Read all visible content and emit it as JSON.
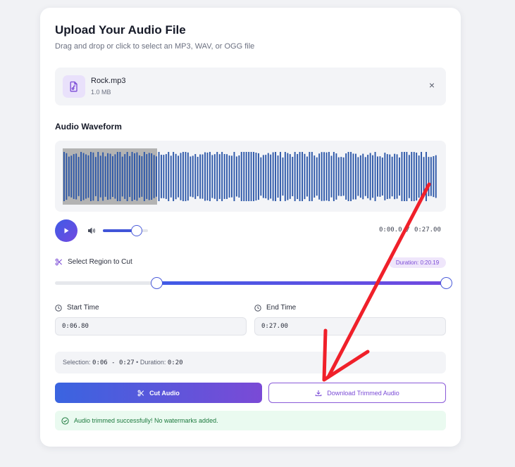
{
  "upload": {
    "title": "Upload Your Audio File",
    "subtitle": "Drag and drop or click to select an MP3, WAV, or OGG file"
  },
  "file": {
    "name": "Rock.mp3",
    "size": "1.0 MB",
    "icon": "audio-file-icon",
    "remove_icon": "×"
  },
  "waveform": {
    "title": "Audio Waveform",
    "selected_color": "#b3b3b3",
    "wave_color": "#2c57a8"
  },
  "player": {
    "play_icon": "play-icon",
    "volume_icon": "speaker-icon",
    "volume_level": 0.75,
    "current_time": "0:00.0",
    "total_time": "0:27.00"
  },
  "region": {
    "label": "Select Region to Cut",
    "duration_badge": "Duration: 0:20.19",
    "start_fraction": 0.26,
    "end_fraction": 1.0
  },
  "start_time": {
    "label": "Start Time",
    "value": "0:06.80"
  },
  "end_time": {
    "label": "End Time",
    "value": "0:27.00"
  },
  "selection": {
    "prefix": "Selection:",
    "range": "0:06 - 0:27",
    "separator": "•",
    "duration_label": "Duration:",
    "duration": "0:20"
  },
  "actions": {
    "cut_label": "Cut Audio",
    "download_label": "Download Trimmed Audio"
  },
  "status": {
    "message": "Audio trimmed successfully! No watermarks added.",
    "color": "#1d7a3e"
  },
  "colors": {
    "accent_start": "#3f5be6",
    "accent_end": "#7249e0",
    "annotation_arrow": "#f0202a"
  }
}
